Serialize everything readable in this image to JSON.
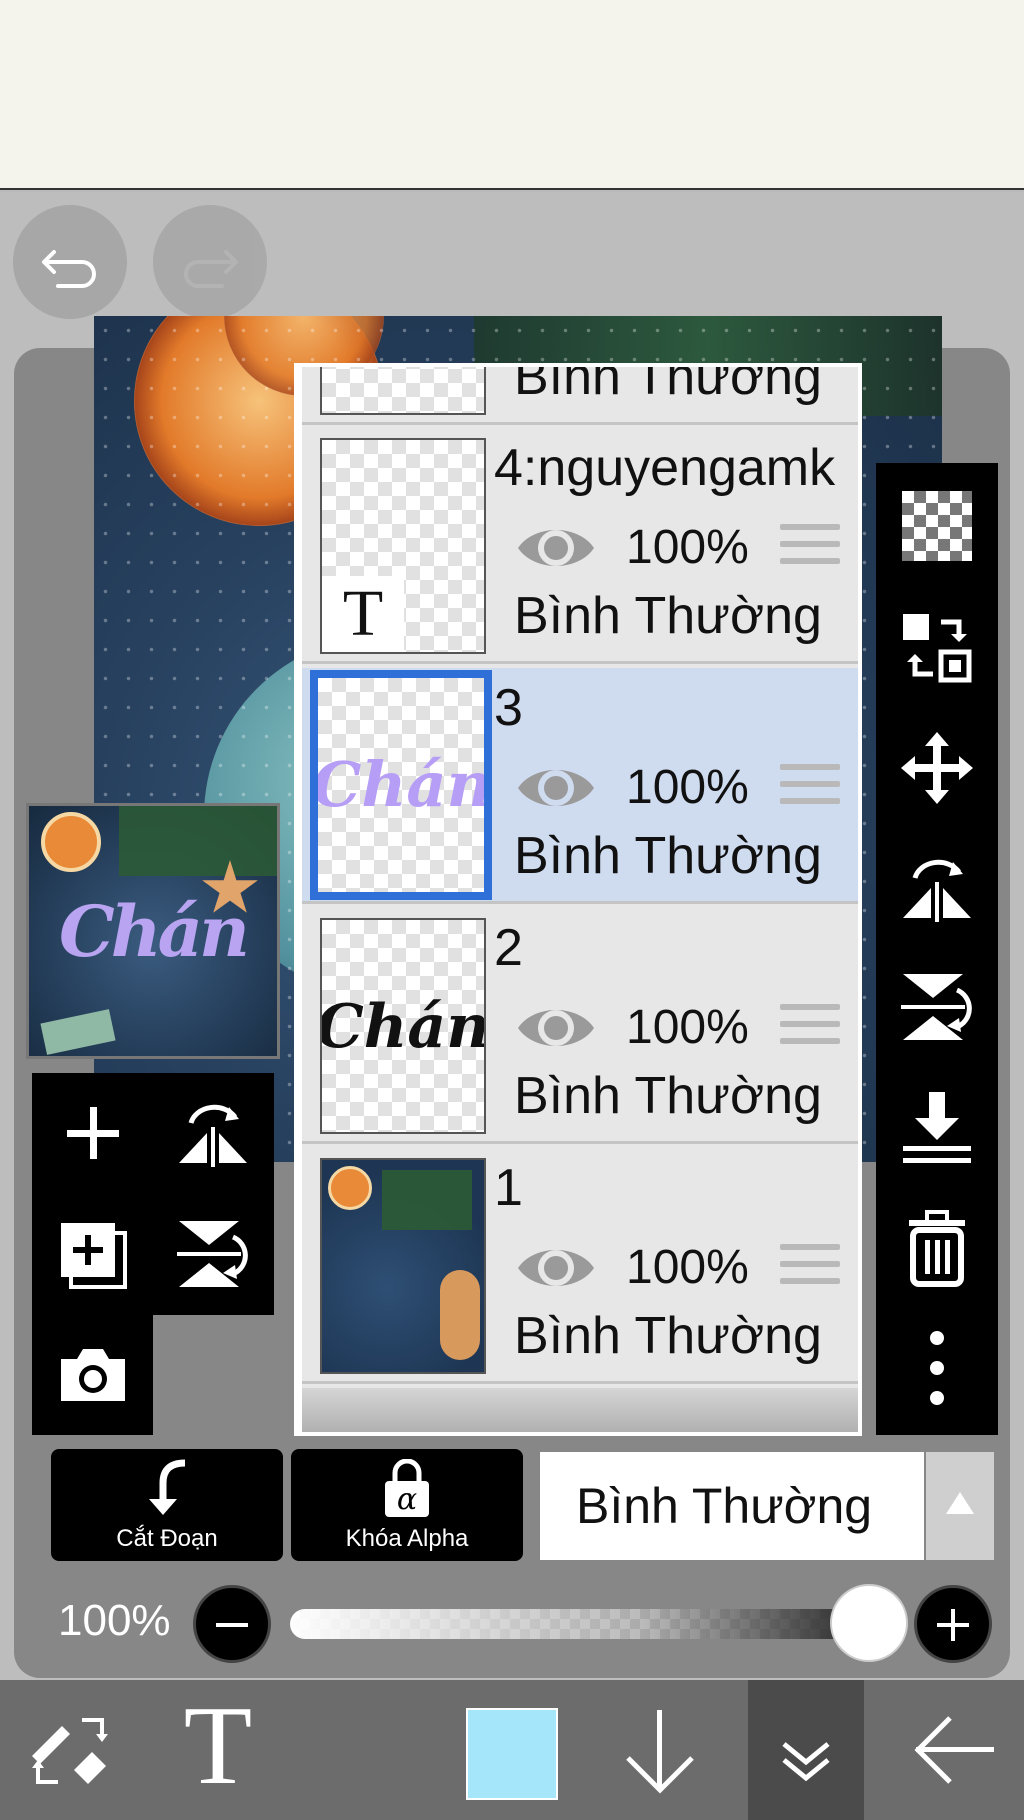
{
  "layers": [
    {
      "name": "",
      "opacity": "",
      "blend": "Bình Thường"
    },
    {
      "name": "4:nguyengamk",
      "opacity": "100%",
      "blend": "Bình Thường",
      "thumb_letter": "T"
    },
    {
      "name": "3",
      "opacity": "100%",
      "blend": "Bình Thường",
      "selected": true
    },
    {
      "name": "2",
      "opacity": "100%",
      "blend": "Bình Thường"
    },
    {
      "name": "1",
      "opacity": "100%",
      "blend": "Bình Thường"
    }
  ],
  "thumb_script_text": "Chán",
  "preview_text": "Chán",
  "actions": {
    "clip_label": "Cắt Đoạn",
    "alpha_label": "Khóa Alpha",
    "alpha_glyph": "α"
  },
  "blend_mode": {
    "selected": "Bình Thường"
  },
  "opacity": {
    "label": "100%",
    "value": 1.0
  },
  "bottom_bar": {
    "text_tool_glyph": "T",
    "color": "#a6e6fb"
  },
  "colors": {
    "selected_row": "#cfdbef",
    "selection_border": "#2e6fd8",
    "panel": "#878787"
  }
}
